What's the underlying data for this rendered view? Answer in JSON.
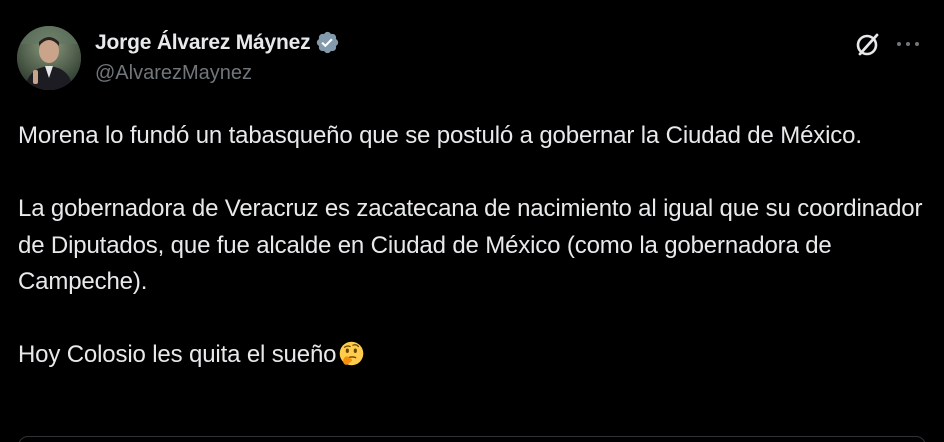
{
  "post": {
    "author": {
      "display_name": "Jorge Álvarez Máynez",
      "handle": "@AlvarezMaynez",
      "verified": true
    },
    "paragraphs": [
      "Morena lo fundó un tabasqueño que se postuló a gobernar la Ciudad de México.",
      "La gobernadora de Veracruz es zacatecana de nacimiento al igual que su coordinador de Diputados, que fue alcalde en Ciudad de México (como la gobernadora de Campeche).",
      "Hoy Colosio les quita el sueño"
    ],
    "final_emoji": "thinking-face-icon"
  },
  "colors": {
    "background": "#000000",
    "primary_text": "#e7e9ea",
    "secondary_text": "#71767b",
    "verified_badge": "#829aab",
    "border": "#2f3336"
  },
  "icons": {
    "verified": "verified-badge-icon",
    "grok": "grok-icon",
    "more": "more-options-icon"
  }
}
